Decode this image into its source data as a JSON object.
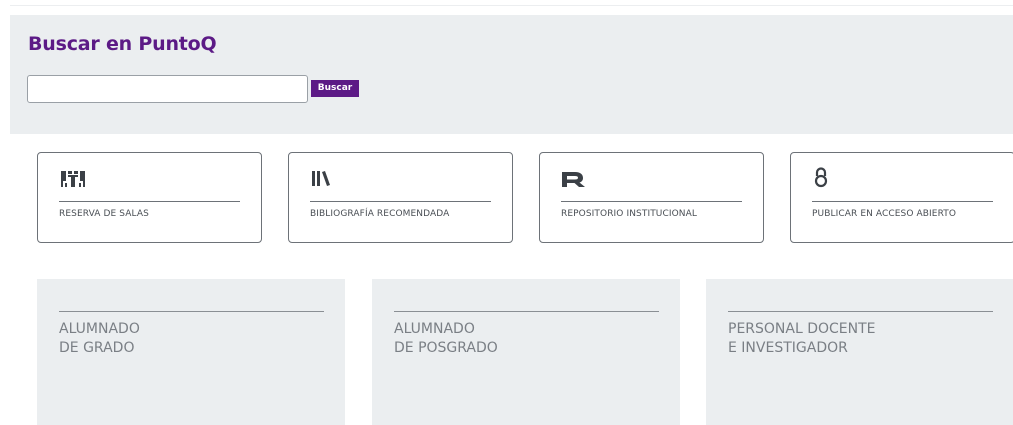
{
  "search": {
    "title": "Buscar en PuntoQ",
    "input_value": "",
    "button_label": "Buscar"
  },
  "services": [
    {
      "label": "RESERVA DE SALAS",
      "icon": "meeting-room-icon"
    },
    {
      "label": "BIBLIOGRAFÍA RECOMENDADA",
      "icon": "books-icon"
    },
    {
      "label": "REPOSITORIO INSTITUCIONAL",
      "icon": "repository-r-icon"
    },
    {
      "label": "PUBLICAR EN ACCESO ABIERTO",
      "icon": "open-access-icon"
    }
  ],
  "profiles": [
    {
      "line1": "ALUMNADO",
      "line2": "DE GRADO"
    },
    {
      "line1": "ALUMNADO",
      "line2": "DE POSGRADO"
    },
    {
      "line1": "PERSONAL DOCENTE",
      "line2": "E INVESTIGADOR"
    }
  ],
  "colors": {
    "brand_purple": "#5c1a86",
    "panel_gray": "#ebeef0",
    "text_gray": "#7a7f85"
  }
}
